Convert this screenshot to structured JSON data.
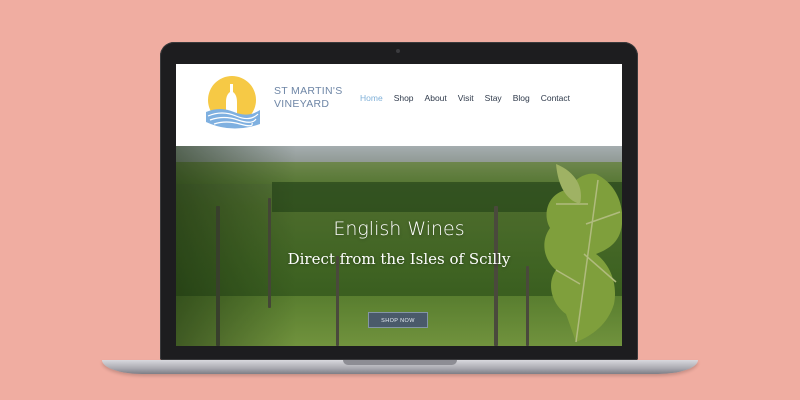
{
  "brand": {
    "line1": "ST MARTIN'S",
    "line2": "VINEYARD"
  },
  "nav": {
    "items": [
      {
        "label": "Home",
        "active": true
      },
      {
        "label": "Shop"
      },
      {
        "label": "About"
      },
      {
        "label": "Visit"
      },
      {
        "label": "Stay"
      },
      {
        "label": "Blog"
      },
      {
        "label": "Contact"
      }
    ]
  },
  "hero": {
    "title": "English Wines",
    "subtitle": "Direct from the Isles of Scilly",
    "cta_label": "SHOP NOW"
  },
  "icons": {
    "logo": "sun-bottle-waves-logo",
    "camera": "camera-icon"
  },
  "colors": {
    "background": "#f0ada1",
    "nav_active": "#7fb0d8",
    "brand_text": "#6e86a6",
    "logo_sun": "#f6c945",
    "logo_waves": "#7fb0e0",
    "button": "#4a5a6a"
  }
}
